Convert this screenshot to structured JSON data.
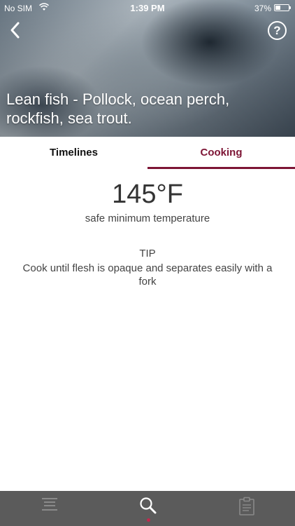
{
  "status_bar": {
    "carrier": "No SIM",
    "time": "1:39 PM",
    "battery": "37%"
  },
  "header": {
    "title": "Lean fish - Pollock, ocean perch, rockfish, sea trout.",
    "help_label": "?"
  },
  "tabs": [
    {
      "label": "Timelines",
      "active": false
    },
    {
      "label": "Cooking",
      "active": true
    }
  ],
  "cooking": {
    "temperature": "145°F",
    "caption": "safe minimum temperature",
    "tip_heading": "TIP",
    "tip_text": "Cook until flesh is opaque and separates easily with a fork"
  },
  "bottom_nav": {
    "items": [
      {
        "icon": "list-icon",
        "active": false
      },
      {
        "icon": "search-icon",
        "active": true
      },
      {
        "icon": "clipboard-icon",
        "active": false
      }
    ]
  },
  "colors": {
    "accent": "#7d1535",
    "nav_background": "#5b5b5b",
    "active_indicator": "#c0294d"
  }
}
